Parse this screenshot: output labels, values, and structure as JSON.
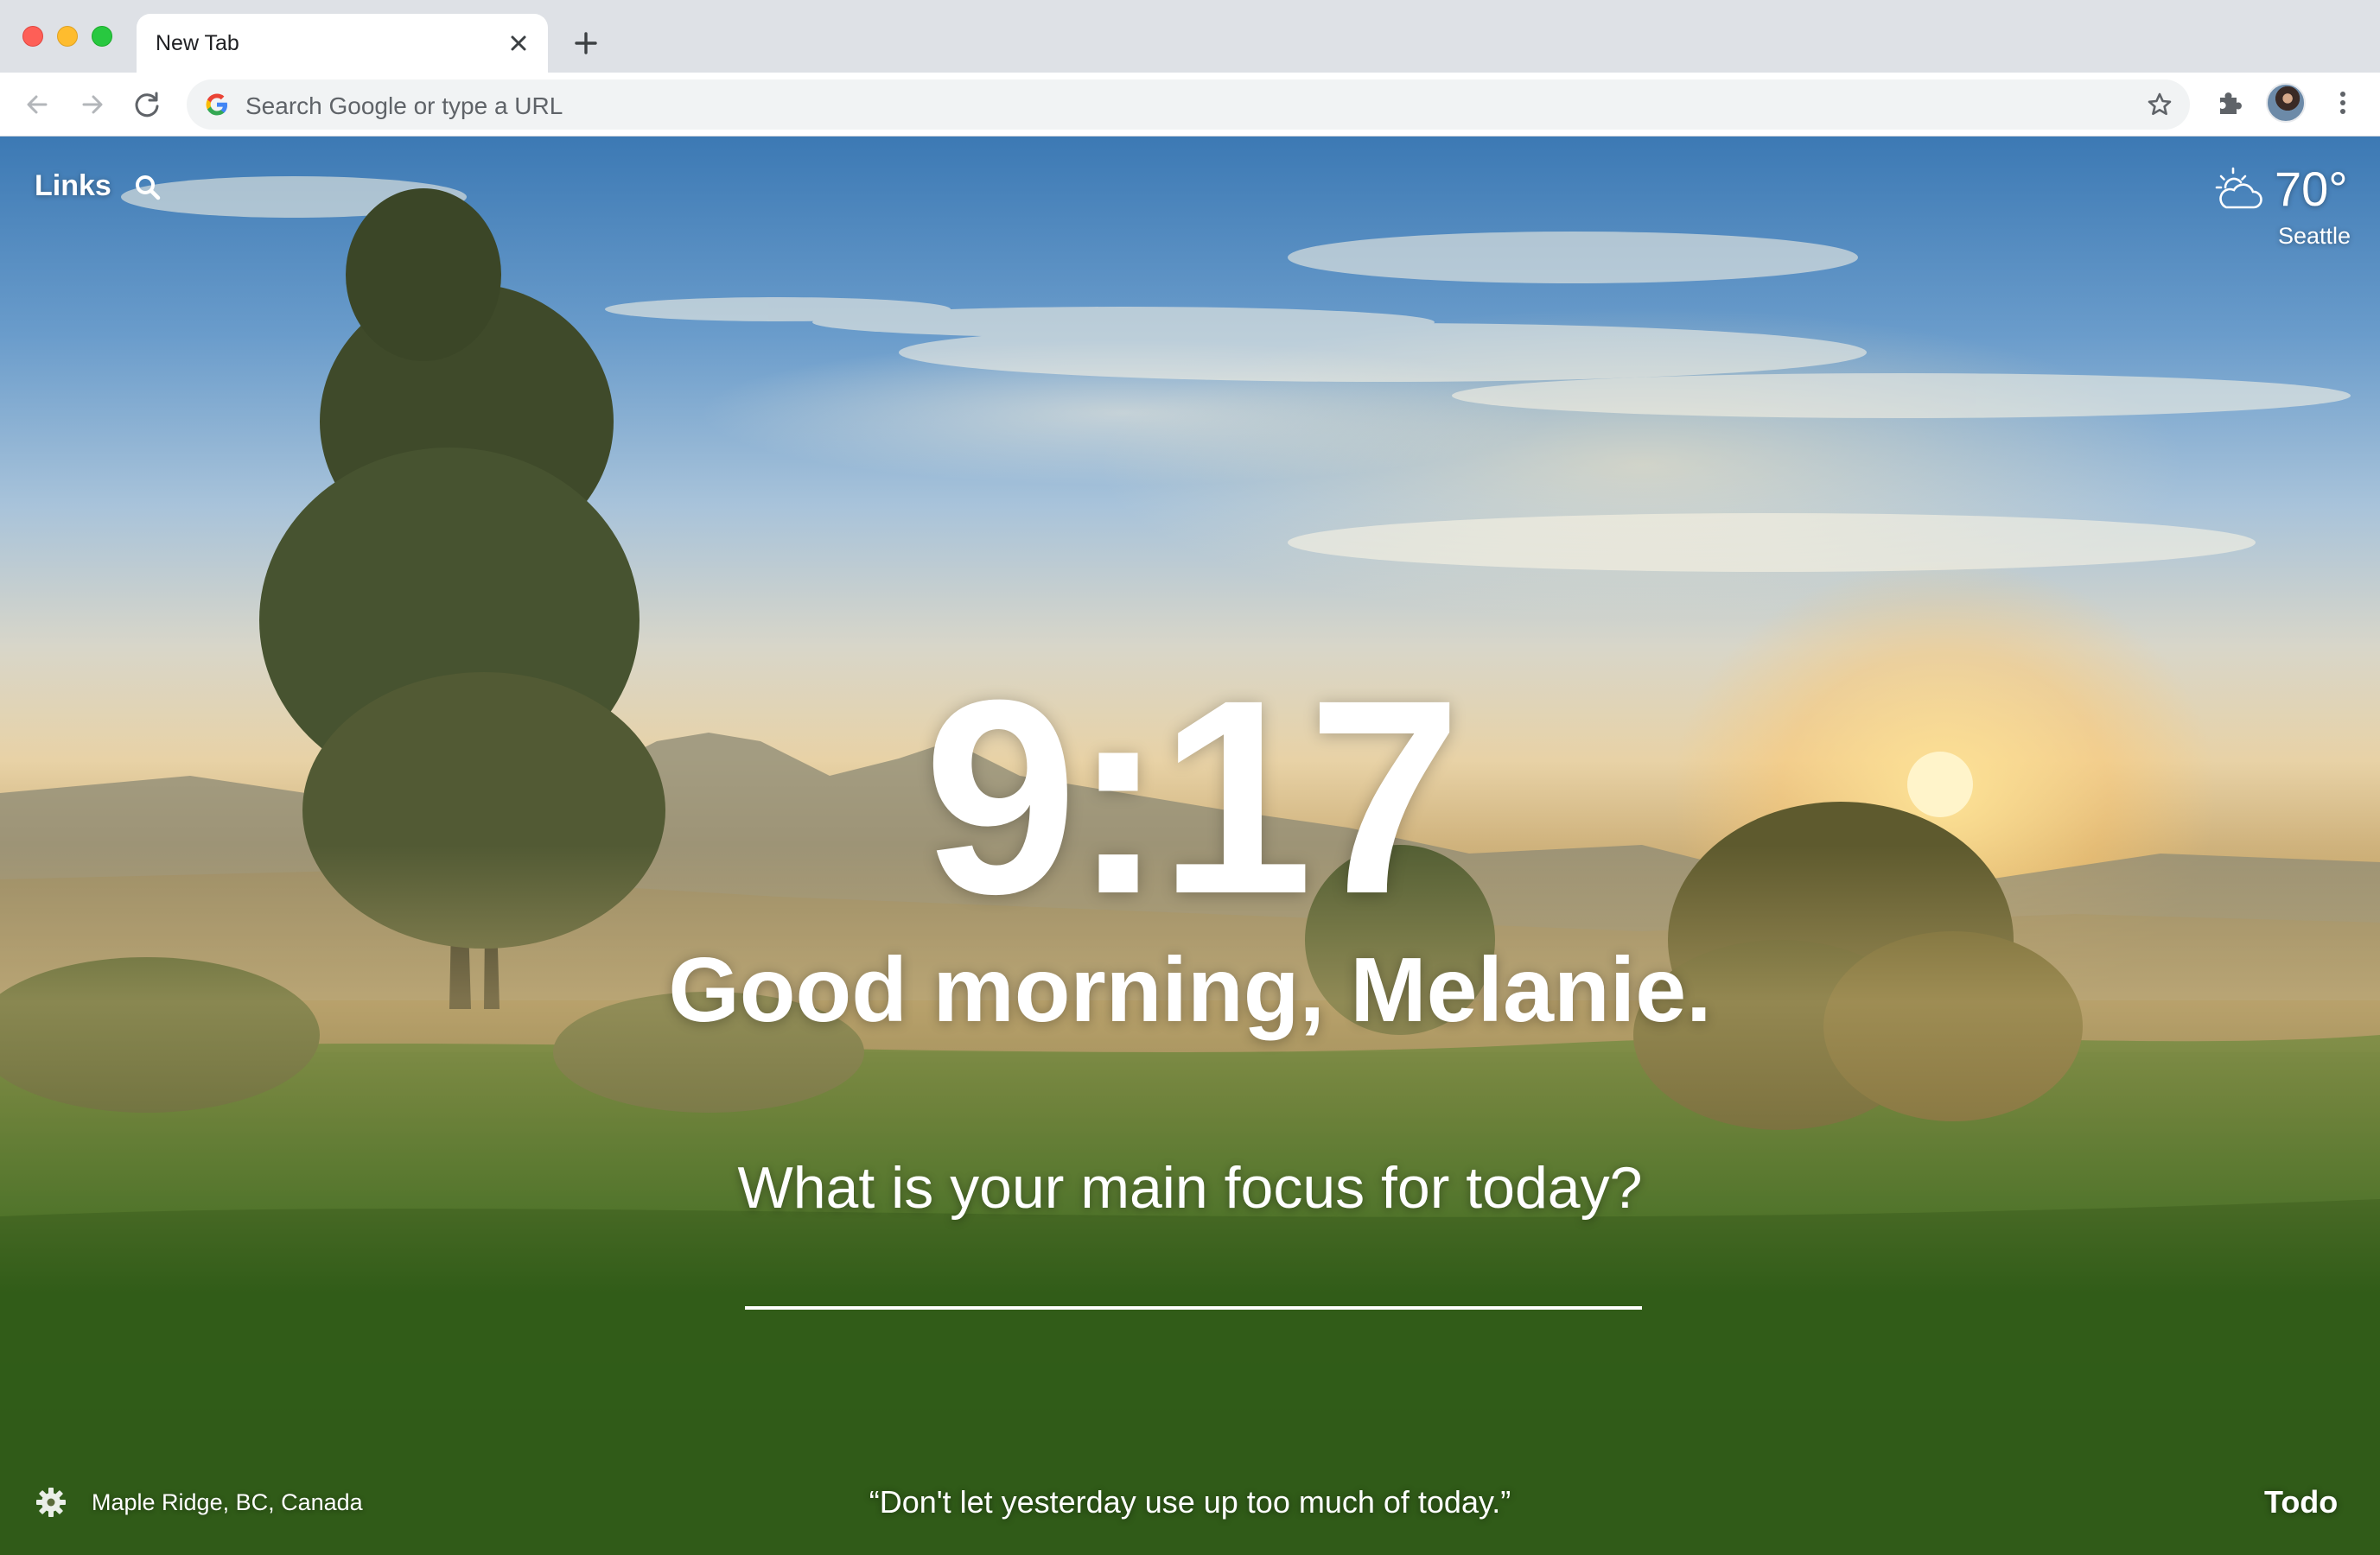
{
  "browser": {
    "tab_title": "New Tab",
    "omnibox_placeholder": "Search Google or type a URL"
  },
  "page": {
    "links_label": "Links",
    "weather": {
      "temp": "70°",
      "city": "Seattle",
      "icon": "partly-cloudy-icon"
    },
    "clock": "9:17",
    "greeting": "Good morning, Melanie.",
    "focus_question": "What is your main focus for today?",
    "focus_input_value": "",
    "photo_location": "Maple Ridge, BC, Canada",
    "quote": "“Don't let yesterday use up too much of today.”",
    "todo_label": "Todo"
  },
  "colors": {
    "tabstrip": "#dee1e6",
    "omnibox": "#f1f3f4",
    "close_red": "#fe5f57",
    "minimize_yellow": "#febc2e",
    "maximize_green": "#28c840"
  }
}
